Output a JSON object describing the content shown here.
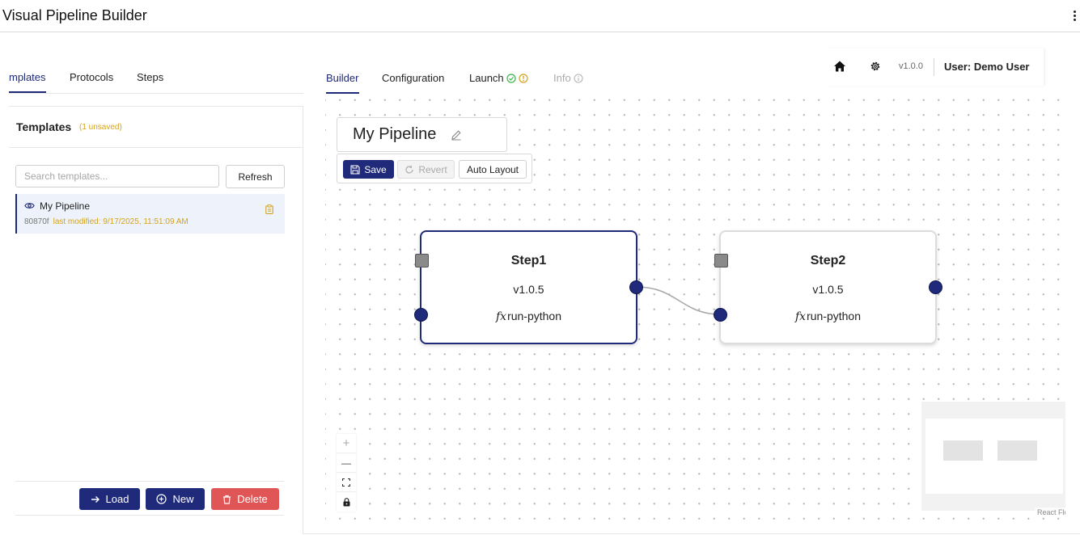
{
  "app": {
    "title": "Visual Pipeline Builder"
  },
  "left_tabs": [
    {
      "label": "Templates",
      "visible_label": "mplates",
      "active": true
    },
    {
      "label": "Protocols",
      "active": false
    },
    {
      "label": "Steps",
      "active": false
    }
  ],
  "templates_panel": {
    "title": "Templates",
    "unsaved_badge": "(1 unsaved)",
    "search_placeholder": "Search templates...",
    "refresh_label": "Refresh",
    "items": [
      {
        "name": "My Pipeline",
        "id": "80870f",
        "modified": "last modified: 9/17/2025, 11:51:09 AM"
      }
    ],
    "actions": {
      "load": "Load",
      "new": "New",
      "delete": "Delete"
    }
  },
  "top_bar": {
    "version": "v1.0.0",
    "user": "User: Demo User"
  },
  "builder_tabs": [
    {
      "label": "Builder",
      "active": true
    },
    {
      "label": "Configuration",
      "active": false
    },
    {
      "label": "Launch",
      "active": false
    },
    {
      "label": "Info",
      "active": false,
      "disabled": true
    }
  ],
  "pipeline": {
    "title": "My Pipeline",
    "toolbar": {
      "save": "Save",
      "revert": "Revert",
      "auto_layout": "Auto Layout"
    },
    "nodes": [
      {
        "title": "Step1",
        "version": "v1.0.5",
        "fn_prefix": "fx",
        "fn": "run-python",
        "selected": true
      },
      {
        "title": "Step2",
        "version": "v1.0.5",
        "fn_prefix": "fx",
        "fn": "run-python",
        "selected": false
      }
    ]
  },
  "canvas": {
    "controls": {
      "zoom_in": "+",
      "zoom_out": "—"
    },
    "attribution": "React Flow"
  },
  "colors": {
    "primary": "#1f2a7a",
    "danger": "#e05555",
    "warning": "#d4a21a",
    "success": "#3db44a"
  },
  "icons": [
    "kebab-menu-icon",
    "eye-icon",
    "clipboard-icon",
    "arrow-right-icon",
    "plus-circle-icon",
    "trash-icon",
    "home-icon",
    "gear-icon",
    "check-circle-icon",
    "warning-circle-icon",
    "info-circle-icon",
    "pencil-icon",
    "floppy-disk-icon",
    "refresh-icon",
    "fit-view-icon",
    "lock-icon"
  ]
}
